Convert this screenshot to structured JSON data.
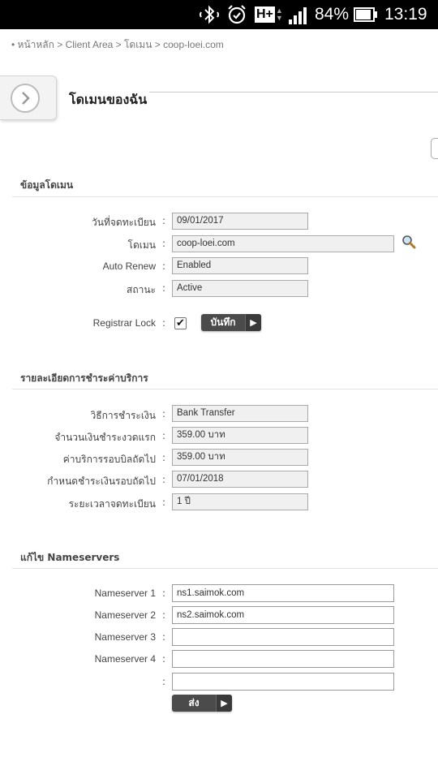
{
  "status_bar": {
    "battery": "84%",
    "time": "13:19",
    "network": "H+"
  },
  "breadcrumb": "• หน้าหลัก > Client Area > โดเมน > coop-loei.com",
  "page_title": "โดเมนของฉัน",
  "domain_info": {
    "header": "ข้อมูลโดเมน",
    "rows": [
      {
        "label": "วันที่จดทะเบียน",
        "value": "09/01/2017"
      },
      {
        "label": "โดเมน",
        "value": "coop-loei.com"
      },
      {
        "label": "Auto Renew",
        "value": "Enabled"
      },
      {
        "label": "สถานะ",
        "value": "Active"
      }
    ],
    "registrar_lock_label": "Registrar Lock",
    "registrar_lock_checked": true,
    "save_label": "บันทึก"
  },
  "billing": {
    "header": "รายละเอียดการชำระค่าบริการ",
    "rows": [
      {
        "label": "วิธีการชำระเงิน",
        "value": "Bank Transfer"
      },
      {
        "label": "จำนวนเงินชำระงวดแรก",
        "value": "359.00 บาท"
      },
      {
        "label": "ค่าบริการรอบบิลถัดไป",
        "value": "359.00 บาท"
      },
      {
        "label": "กำหนดชำระเงินรอบถัดไป",
        "value": "07/01/2018"
      },
      {
        "label": "ระยะเวลาจดทะเบียน",
        "value": "1 ปี"
      }
    ]
  },
  "nameservers": {
    "header": "แก้ไข Nameservers",
    "rows": [
      {
        "label": "Nameserver 1",
        "value": "ns1.saimok.com"
      },
      {
        "label": "Nameserver 2",
        "value": "ns2.saimok.com"
      },
      {
        "label": "Nameserver 3",
        "value": ""
      },
      {
        "label": "Nameserver 4",
        "value": ""
      },
      {
        "label": "",
        "value": ""
      }
    ],
    "submit_label": "ส่ง"
  }
}
